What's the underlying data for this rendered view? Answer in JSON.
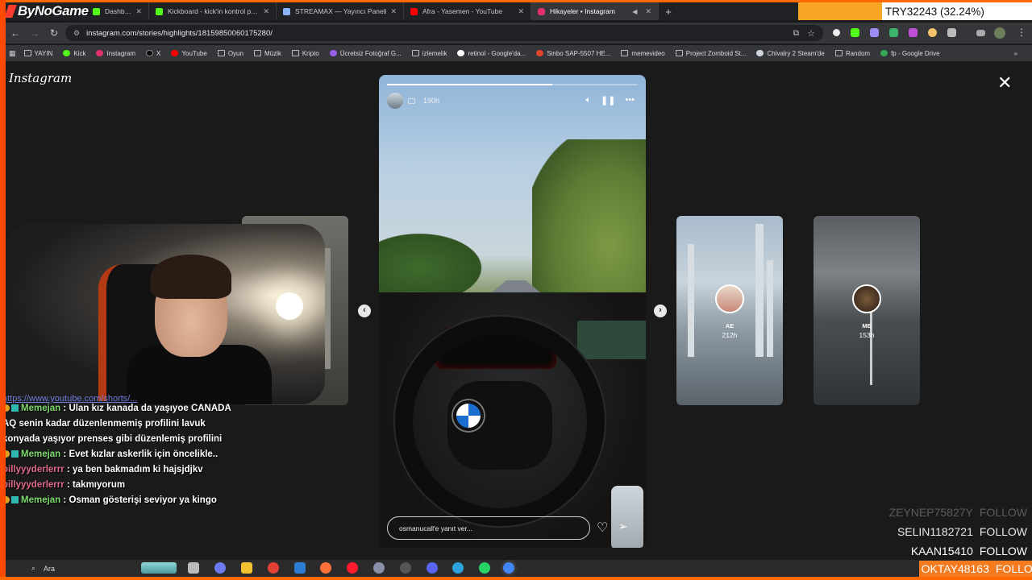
{
  "stream": {
    "logo_text": "ByNoGame",
    "counter": "TRY32243 (32.24%)"
  },
  "tabs": [
    {
      "label": "Dashboard",
      "fav": "#53fc18",
      "active": false
    },
    {
      "label": "Kickboard - kick'in kontrol paneli",
      "fav": "#53fc18",
      "active": false
    },
    {
      "label": "STREAMAX — Yayıncı Paneli",
      "fav": "#8ab4f8",
      "active": false
    },
    {
      "label": "Afra - Yasemen - YouTube",
      "fav": "#ff0000",
      "active": false
    },
    {
      "label": "Hikayeler • Instagram",
      "fav": "#e1306c",
      "active": true
    }
  ],
  "address": {
    "url": "instagram.com/stories/highlights/18159850060175280/"
  },
  "bookmarks": [
    {
      "label": "YAYIN",
      "icon": "folder-icon"
    },
    {
      "label": "Kick",
      "icon": "kick-icon"
    },
    {
      "label": "Instagram",
      "icon": "instagram-icon"
    },
    {
      "label": "X",
      "icon": "x-icon"
    },
    {
      "label": "YouTube",
      "icon": "youtube-icon"
    },
    {
      "label": "Oyun",
      "icon": "folder-icon"
    },
    {
      "label": "Müzik",
      "icon": "folder-icon"
    },
    {
      "label": "Kripto",
      "icon": "folder-icon"
    },
    {
      "label": "Ücretsiz Fotoğraf G...",
      "icon": "photo-icon"
    },
    {
      "label": "izlemelik",
      "icon": "folder-icon"
    },
    {
      "label": "retinol - Google'da...",
      "icon": "google-icon"
    },
    {
      "label": "Sinbo SAP-5507 HE...",
      "icon": "shop-icon"
    },
    {
      "label": "memevideo",
      "icon": "folder-icon"
    },
    {
      "label": "Project Zomboid St...",
      "icon": "folder-icon"
    },
    {
      "label": "Chivalry 2 Steam'de",
      "icon": "steam-icon"
    },
    {
      "label": "Random",
      "icon": "folder-icon"
    },
    {
      "label": "fp - Google Drive",
      "icon": "drive-icon"
    }
  ],
  "instagram": {
    "logo": "Instagram",
    "story": {
      "time": "190h",
      "progress": 0.66,
      "reply_placeholder": "osmanucall'e yanıt ver..."
    },
    "side_stories": [
      {
        "name": "AE",
        "time": "212h"
      },
      {
        "name": "ME",
        "time": "153h"
      }
    ]
  },
  "chat": {
    "link": "https://www.youtube.com/shorts/...",
    "messages": [
      {
        "user": "Memejan",
        "badges": true,
        "text": "Ulan kız kanada da yaşıyoe CANADA AQ senin kadar düzenlenmemiş profilini lavuk konyada yaşıyor prenses gibi düzenlemiş profilini"
      },
      {
        "user": "Memejan",
        "badges": true,
        "text": "Evet kızlar askerlik için öncelikle.."
      },
      {
        "user": "billyyyderlerrr",
        "badges": false,
        "text": "ya ben bakmadım ki hajsjdjkv"
      },
      {
        "user": "billyyyderlerrr",
        "badges": false,
        "text": "takmıyorum"
      },
      {
        "user": "Memejan",
        "badges": true,
        "text": "Osman gösterişi seviyor ya kingo"
      }
    ]
  },
  "follows": [
    {
      "name": "ZEYNEP75827Y",
      "action": "FOLLOW"
    },
    {
      "name": "SELIN1182721",
      "action": "FOLLOW"
    },
    {
      "name": "KAAN15410",
      "action": "FOLLOW"
    },
    {
      "name": "OKTAY48163",
      "action": "FOLLOW"
    }
  ],
  "taskbar": {
    "search_label": "Ara"
  }
}
